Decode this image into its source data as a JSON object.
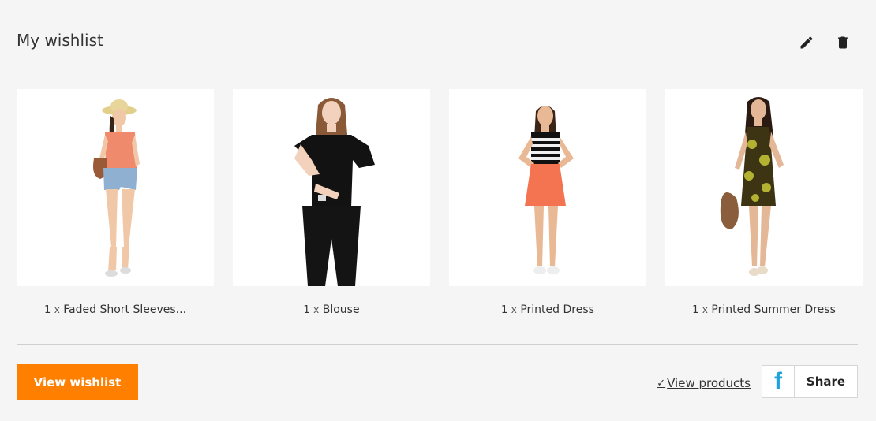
{
  "header": {
    "title": "My wishlist",
    "edit_icon": "pencil-icon",
    "delete_icon": "trash-icon"
  },
  "products": [
    {
      "qty": "1",
      "x": "x",
      "name": "Faded Short Sleeves..."
    },
    {
      "qty": "1",
      "x": "x",
      "name": "Blouse"
    },
    {
      "qty": "1",
      "x": "x",
      "name": "Printed Dress"
    },
    {
      "qty": "1",
      "x": "x",
      "name": "Printed Summer Dress"
    }
  ],
  "footer": {
    "view_wishlist_label": "View wishlist",
    "view_products_label": "View products",
    "share_icon": "facebook-icon",
    "share_icon_glyph": "f",
    "share_label": "Share"
  },
  "colors": {
    "accent": "#ff7f00",
    "facebook": "#1fa3dc",
    "background": "#f5f5f5"
  }
}
